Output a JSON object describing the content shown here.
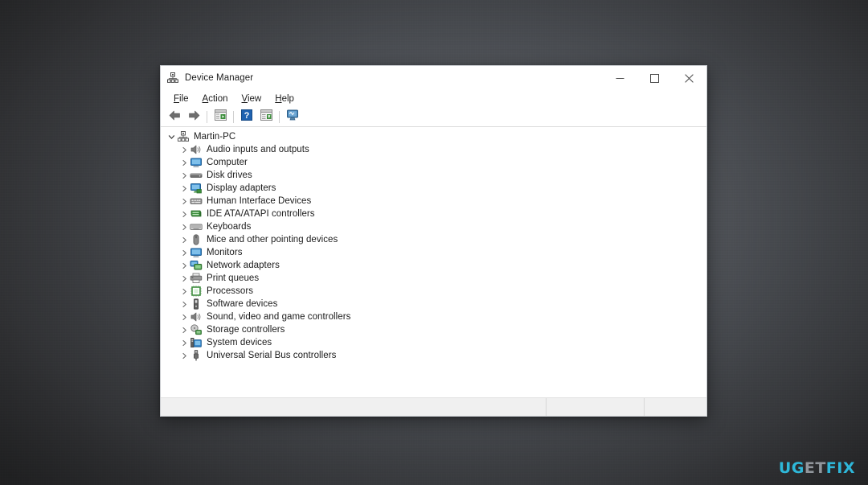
{
  "window": {
    "title": "Device Manager",
    "title_icon": "device-manager-icon",
    "controls": {
      "minimize": "–",
      "maximize": "□",
      "close": "×"
    }
  },
  "menubar": {
    "items": [
      {
        "label": "File",
        "accel": "F",
        "rest": "ile",
        "name": "menu-file"
      },
      {
        "label": "Action",
        "accel": "A",
        "rest": "ction",
        "name": "menu-action"
      },
      {
        "label": "View",
        "accel": "V",
        "rest": "iew",
        "name": "menu-view"
      },
      {
        "label": "Help",
        "accel": "H",
        "rest": "elp",
        "name": "menu-help"
      }
    ]
  },
  "toolbar": {
    "buttons": [
      {
        "name": "back-button",
        "icon": "back-arrow-icon"
      },
      {
        "name": "forward-button",
        "icon": "forward-arrow-icon"
      },
      {
        "name": "show-hide-tree-button",
        "icon": "tree-pane-icon"
      },
      {
        "name": "help-button",
        "icon": "help-question-icon"
      },
      {
        "name": "properties-button",
        "icon": "properties-icon"
      },
      {
        "name": "scan-hardware-button",
        "icon": "scan-monitor-icon"
      }
    ]
  },
  "tree": {
    "root": {
      "label": "Martin-PC",
      "icon": "computer-root-icon",
      "expanded": true
    },
    "items": [
      {
        "label": "Audio inputs and outputs",
        "icon": "speaker-icon"
      },
      {
        "label": "Computer",
        "icon": "monitor-icon"
      },
      {
        "label": "Disk drives",
        "icon": "disk-drive-icon"
      },
      {
        "label": "Display adapters",
        "icon": "display-adapter-icon"
      },
      {
        "label": "Human Interface Devices",
        "icon": "hid-icon"
      },
      {
        "label": "IDE ATA/ATAPI controllers",
        "icon": "ide-controller-icon"
      },
      {
        "label": "Keyboards",
        "icon": "keyboard-icon"
      },
      {
        "label": "Mice and other pointing devices",
        "icon": "mouse-icon"
      },
      {
        "label": "Monitors",
        "icon": "monitor-icon"
      },
      {
        "label": "Network adapters",
        "icon": "network-adapter-icon"
      },
      {
        "label": "Print queues",
        "icon": "printer-icon"
      },
      {
        "label": "Processors",
        "icon": "processor-icon"
      },
      {
        "label": "Software devices",
        "icon": "software-device-icon"
      },
      {
        "label": "Sound, video and game controllers",
        "icon": "speaker-icon"
      },
      {
        "label": "Storage controllers",
        "icon": "storage-controller-icon"
      },
      {
        "label": "System devices",
        "icon": "system-device-icon"
      },
      {
        "label": "Universal Serial Bus controllers",
        "icon": "usb-icon"
      }
    ]
  },
  "statusbar": {
    "segment1": "",
    "segment2": "",
    "segment3": ""
  },
  "watermark": {
    "part1": "UG",
    "part2": "ET",
    "part3": "FIX"
  },
  "colors": {
    "accent_cyan": "#2fc4e8",
    "watermark_grey": "#9aa0a6",
    "window_bg": "#ffffff",
    "statusbar_bg": "#f0f0f0",
    "desktop_bg": "#4a4d52",
    "help_icon_blue": "#1f62b0"
  }
}
